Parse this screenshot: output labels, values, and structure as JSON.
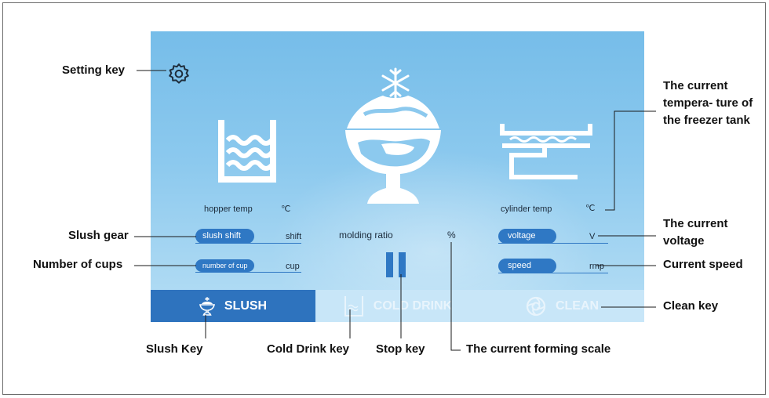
{
  "screen": {
    "hopper_temp_label": "hopper temp",
    "hopper_temp_unit": "℃",
    "cylinder_temp_label": "cylinder temp",
    "cylinder_temp_unit": "℃",
    "slush_shift_label": "slush shift",
    "slush_shift_unit": "shift",
    "number_of_cup_label": "number of cup",
    "number_of_cup_unit": "cup",
    "molding_ratio_label": "molding ratio",
    "molding_ratio_unit": "%",
    "voltage_label": "voltage",
    "voltage_unit": "V",
    "speed_label": "speed",
    "speed_unit": "rmp"
  },
  "tabs": [
    {
      "label": "SLUSH",
      "icon": "slush-cup-icon"
    },
    {
      "label": "COLD DRINK",
      "icon": "cold-drink-icon"
    },
    {
      "label": "CLEAN",
      "icon": "clean-icon"
    }
  ],
  "annotations": {
    "setting_key": "Setting key",
    "slush_gear": "Slush gear",
    "number_of_cups": "Number of cups",
    "freezer_temp": "The current tempera- ture of the freezer tank",
    "current_voltage": "The current voltage",
    "current_speed": "Current speed",
    "clean_key": "Clean key",
    "slush_key": "Slush Key",
    "cold_drink_key": "Cold Drink key",
    "stop_key": "Stop key",
    "forming_scale": "The current forming scale"
  },
  "colors": {
    "screen_top": "#76bde9",
    "accent_blue": "#2f78c4",
    "tab_active": "#2e73be",
    "tab_inactive_text": "#e8f4fc"
  }
}
